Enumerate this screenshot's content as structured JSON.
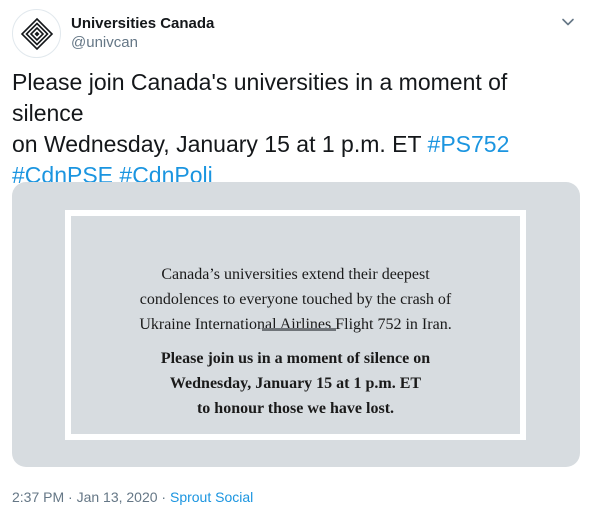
{
  "author": {
    "display_name": "Universities Canada",
    "handle": "@univcan",
    "avatar_icon": "univcan-logo-icon"
  },
  "tweet": {
    "text_line1": "Please join Canada's universities in a moment of silence",
    "text_line2_prefix": "on Wednesday, January 15 at 1 p.m. ET ",
    "hashtags": [
      "#PS752",
      "#CdnPSE",
      "#CdnPoli"
    ]
  },
  "media_card": {
    "paragraph1": [
      "Canada’s universities extend their deepest",
      "condolences to everyone touched by the crash of",
      "Ukraine International Airlines Flight 752 in Iran."
    ],
    "paragraph2": [
      "Please join us in a moment of silence on",
      "Wednesday, January 15 at 1 p.m. ET",
      "to honour those we have lost."
    ]
  },
  "footer": {
    "timestamp": "2:37 PM · Jan 13, 2020 · ",
    "source": "Sprout Social"
  },
  "colors": {
    "hashtag": "#1b95e0",
    "secondary_text": "#657786",
    "media_bg": "#d7dce0"
  }
}
